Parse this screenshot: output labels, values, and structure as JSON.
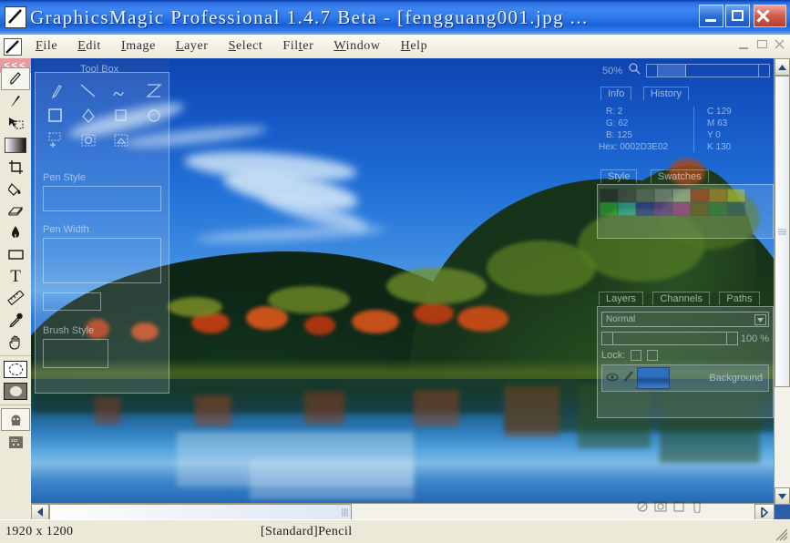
{
  "window": {
    "title": "GraphicsMagic Professional 1.4.7 Beta - [fengguang001.jpg ...",
    "minimize_label": "Minimize",
    "maximize_label": "Maximize",
    "close_label": "Close",
    "app_icon": "pencil-app-icon",
    "title_bar_color": "#2e79ea",
    "close_button_color": "#d4604f"
  },
  "menubar": {
    "items": [
      {
        "label": "File",
        "accel": "F"
      },
      {
        "label": "Edit",
        "accel": "E"
      },
      {
        "label": "Image",
        "accel": "I"
      },
      {
        "label": "Layer",
        "accel": "L"
      },
      {
        "label": "Select",
        "accel": "S"
      },
      {
        "label": "Filter",
        "accel": "t"
      },
      {
        "label": "Window",
        "accel": "W"
      },
      {
        "label": "Help",
        "accel": "H"
      }
    ],
    "mdi_buttons": [
      "minimize-child",
      "restore-child",
      "close-child"
    ]
  },
  "toolbox": {
    "collapse_label": "<<<",
    "collapse_color": "#e89a9e",
    "tools": [
      {
        "name": "pencil-tool",
        "icon": "pencil",
        "selected": true
      },
      {
        "name": "brush-tool",
        "icon": "brush",
        "selected": false
      },
      {
        "name": "move-tool",
        "icon": "move",
        "selected": false
      },
      {
        "name": "gradient-tool",
        "icon": "gradient",
        "selected": false
      },
      {
        "name": "crop-tool",
        "icon": "crop",
        "selected": false
      },
      {
        "name": "paint-bucket-tool",
        "icon": "paint-bucket",
        "selected": false
      },
      {
        "name": "eraser-tool",
        "icon": "eraser",
        "selected": false
      },
      {
        "name": "ink-pen-tool",
        "icon": "ink-pen",
        "selected": false
      },
      {
        "name": "rectangle-tool",
        "icon": "rectangle",
        "selected": false
      },
      {
        "name": "text-tool",
        "icon": "text",
        "selected": false
      },
      {
        "name": "measure-tool",
        "icon": "ruler",
        "selected": false
      },
      {
        "name": "eyedropper-tool",
        "icon": "eyedropper",
        "selected": false
      },
      {
        "name": "hand-tool",
        "icon": "hand",
        "selected": false
      },
      {
        "name": "foreground-color",
        "icon": "color-square-light",
        "selected": false
      },
      {
        "name": "background-color",
        "icon": "color-square-dark",
        "selected": false
      },
      {
        "name": "quickmask-tool",
        "icon": "quickmask",
        "selected": false
      },
      {
        "name": "screenmode-tool",
        "icon": "screen-mode",
        "selected": false
      }
    ]
  },
  "floating_tools_palette": {
    "title": "Tool Box",
    "row1": [
      "pen-icon",
      "line-icon",
      "curve-icon",
      "polygon-icon"
    ],
    "row2": [
      "filled-square-icon",
      "diamond-icon",
      "square-icon",
      "circle-icon"
    ],
    "row3": [
      "move-selection-icon",
      "marquee-icon",
      "marquee-dashed-icon"
    ],
    "sections": [
      {
        "label": "Pen Style"
      },
      {
        "label": "Pen Width"
      },
      {
        "label": "Brush Style"
      }
    ]
  },
  "navigator": {
    "zoom_label": "50%",
    "zoom_icon": "magnifier-icon",
    "slider_left_icon": "triangle-left",
    "slider_right_icon": "triangle-right"
  },
  "info_panel": {
    "tabs": [
      "Info",
      "History"
    ],
    "active_tab": "Info",
    "left_readout": [
      {
        "channel": "R",
        "value": "2"
      },
      {
        "channel": "G",
        "value": "62"
      },
      {
        "channel": "B",
        "value": "125"
      },
      {
        "channel": "Hex",
        "value": "0002D3E02"
      }
    ],
    "right_readout": [
      {
        "channel": "C",
        "value": "129"
      },
      {
        "channel": "M",
        "value": "63"
      },
      {
        "channel": "Y",
        "value": "0"
      },
      {
        "channel": "K",
        "value": "130"
      }
    ]
  },
  "style_panel": {
    "tabs": [
      "Style",
      "Swatches"
    ],
    "active_tab": "Swatches",
    "swatch_colors": [
      "#000000",
      "#404040",
      "#808080",
      "#c0c0c0",
      "#ffffff",
      "#ff0000",
      "#ff8000",
      "#ffff00",
      "#00ff00",
      "#00ffff",
      "#0000ff",
      "#8000ff",
      "#ff00ff",
      "#804000",
      "#008040",
      "#004080"
    ]
  },
  "layers_panel": {
    "tabs": [
      "Layers",
      "Channels",
      "Paths"
    ],
    "active_tab": "Layers",
    "blend_mode": "Normal",
    "opacity_label": "100",
    "opacity_unit": "%",
    "lock_label": "Lock:",
    "layers": [
      {
        "name": "Background",
        "visible": true,
        "thumbnail": "landscape-thumb",
        "brush_icon": "brush-icon"
      }
    ],
    "footer_buttons": [
      "new-effect-icon",
      "mask-icon",
      "new-layer-icon",
      "delete-layer-icon"
    ]
  },
  "scrollbars": {
    "h_left_icon": "chevron-left",
    "h_right_icon": "chevron-right",
    "v_up_icon": "chevron-up",
    "v_down_icon": "chevron-down"
  },
  "statusbar": {
    "dimensions": "1920 x 1200",
    "active_tool": "[Standard]Pencil"
  },
  "document": {
    "filename": "fengguang001.jpg",
    "subject": "autumn lake landscape with forested hills and mirror reflection"
  }
}
